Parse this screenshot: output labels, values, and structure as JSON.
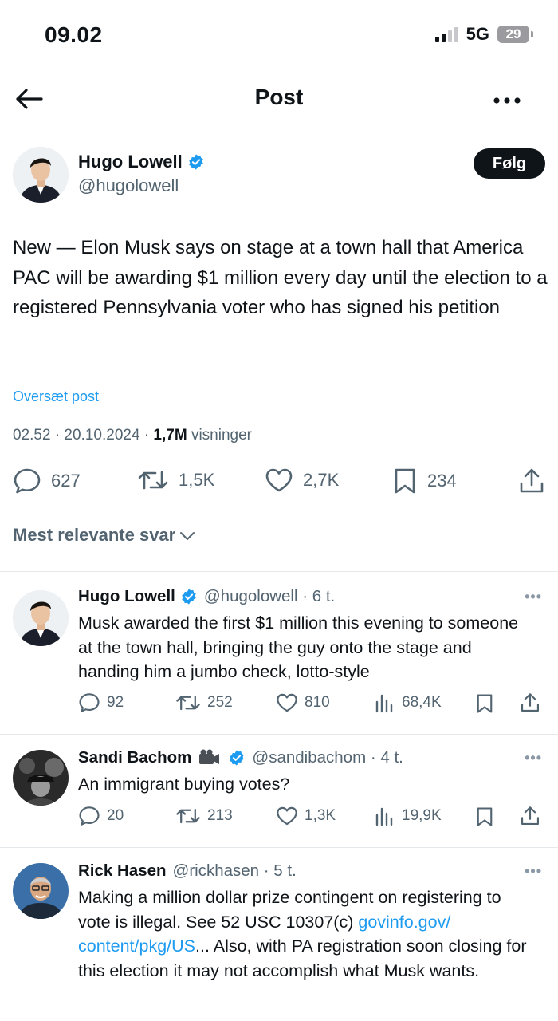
{
  "status_bar": {
    "time": "09.02",
    "network": "5G",
    "battery": "29"
  },
  "nav": {
    "title": "Post"
  },
  "post": {
    "author_name": "Hugo Lowell",
    "author_handle": "@hugolowell",
    "follow_label": "Følg",
    "text": "New — Elon Musk says on stage at a town hall that America PAC will be awarding $1 million every day until the election to a registered Pennsylvania voter who has signed his petition",
    "translate_label": "Oversæt post",
    "time_date": "02.52 · 20.10.2024 · ",
    "views_count": "1,7M",
    "views_label": " visninger",
    "replies": "627",
    "reposts": "1,5K",
    "likes": "2,7K",
    "bookmarks": "234"
  },
  "sort_label": "Mest relevante svar",
  "replies": [
    {
      "name": "Hugo Lowell",
      "handle_time": "@hugolowell · 6 t.",
      "text": "Musk awarded the first $1 million this evening to someone at the town hall, bringing the guy onto the stage and handing him a jumbo check, lotto-style",
      "replies": "92",
      "reposts": "252",
      "likes": "810",
      "views": "68,4K"
    },
    {
      "name": "Sandi Bachom",
      "handle_time": "@sandibachom · 4 t.",
      "text": "An immigrant buying votes?",
      "replies": "20",
      "reposts": "213",
      "likes": "1,3K",
      "views": "19,9K"
    },
    {
      "name": "Rick Hasen",
      "handle_time": "@rickhasen · 5 t.",
      "text_part1": "Making a million dollar prize contingent on registering to vote is illegal. See 52 USC 10307(c) ",
      "text_link": "govinfo.gov/ content/pkg/US",
      "text_part2": "... Also, with PA registration soon closing for this election it may not accomplish what Musk wants."
    }
  ],
  "colors": {
    "accent": "#1d9bf0",
    "text": "#0f1419",
    "muted": "#536471"
  }
}
